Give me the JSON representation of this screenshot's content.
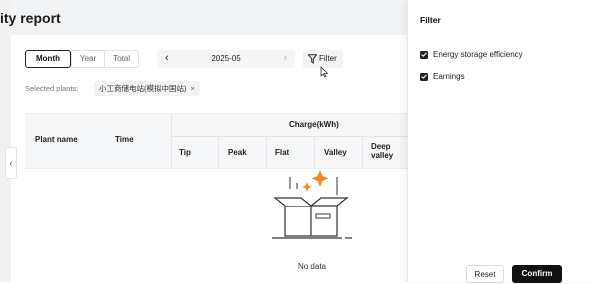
{
  "page": {
    "title": "ity report"
  },
  "period_tabs": [
    "Month",
    "Year",
    "Total"
  ],
  "period_selected": "Month",
  "date_picker": {
    "value": "2025-05"
  },
  "filter_button": {
    "label": "Filter"
  },
  "selected_plants": {
    "label": "Selected plants:",
    "tags": [
      "小工商储电站(模拟中国站)"
    ]
  },
  "table": {
    "columns": {
      "plant_name": "Plant name",
      "time": "Time",
      "charge_group": "Charge(kWh)"
    },
    "sub_columns": [
      "Tip",
      "Peak",
      "Flat",
      "Valley",
      "Deep valley"
    ],
    "empty_text": "No data"
  },
  "filter_panel": {
    "title": "Filter",
    "options": [
      {
        "label": "Energy storage efficiency",
        "checked": true
      },
      {
        "label": "Earnings",
        "checked": true
      }
    ],
    "reset_label": "Reset",
    "confirm_label": "Confirm"
  },
  "colors": {
    "accent": "#f08a24",
    "primary_button": "#111111"
  },
  "icons": [
    "filter-icon",
    "chevron-left-icon",
    "chevron-right-icon",
    "close-icon",
    "checkbox-icon",
    "empty-box-icon",
    "collapse-arrow-icon",
    "cursor-icon"
  ]
}
